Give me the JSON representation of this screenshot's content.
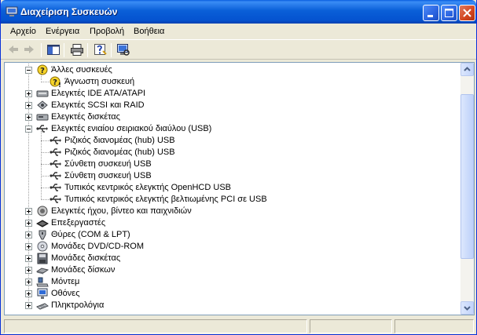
{
  "window": {
    "title": "Διαχείριση Συσκευών"
  },
  "menu": [
    {
      "label": "Αρχείο"
    },
    {
      "label": "Ενέργεια"
    },
    {
      "label": "Προβολή"
    },
    {
      "label": "Βοήθεια"
    }
  ],
  "tree": {
    "items": [
      {
        "label": "Άλλες συσκευές",
        "icon": "unknown-device-category-icon"
      },
      {
        "label": "Άγνωστη συσκευή",
        "icon": "unknown-device-icon"
      },
      {
        "label": "Ελεγκτές IDE ATA/ATAPI",
        "icon": "ide-controller-icon"
      },
      {
        "label": "Ελεγκτές SCSI και RAID",
        "icon": "scsi-controller-icon"
      },
      {
        "label": "Ελεγκτές δισκέτας",
        "icon": "floppy-controller-icon"
      },
      {
        "label": "Ελεγκτές ενιαίου σειριακού διαύλου (USB)",
        "icon": "usb-icon"
      },
      {
        "label": "Ριζικός διανομέας (hub) USB",
        "icon": "usb-icon"
      },
      {
        "label": "Ριζικός διανομέας (hub) USB",
        "icon": "usb-icon"
      },
      {
        "label": "Σύνθετη συσκευή USB",
        "icon": "usb-icon"
      },
      {
        "label": "Σύνθετη συσκευή USB",
        "icon": "usb-icon"
      },
      {
        "label": "Τυπικός κεντρικός ελεγκτής OpenHCD USB",
        "icon": "usb-icon"
      },
      {
        "label": "Τυπικός κεντρικός ελεγκτής βελτιωμένης PCI σε USB",
        "icon": "usb-icon"
      },
      {
        "label": "Ελεγκτές ήχου, βίντεο και παιχνιδιών",
        "icon": "sound-icon"
      },
      {
        "label": "Επεξεργαστές",
        "icon": "processor-icon"
      },
      {
        "label": "Θύρες (COM & LPT)",
        "icon": "port-icon"
      },
      {
        "label": "Μονάδες DVD/CD-ROM",
        "icon": "cdrom-icon"
      },
      {
        "label": "Μονάδες δισκέτας",
        "icon": "floppy-drive-icon"
      },
      {
        "label": "Μονάδες δίσκων",
        "icon": "disk-drive-icon"
      },
      {
        "label": "Μόντεμ",
        "icon": "modem-icon"
      },
      {
        "label": "Οθόνες",
        "icon": "monitor-icon"
      },
      {
        "label": "Πληκτρολόγια",
        "icon": "keyboard-icon"
      }
    ]
  },
  "colors": {
    "titlebar": "#0a5fd8",
    "window_bg": "#ece9d8",
    "tree_border": "#7f9db9"
  }
}
